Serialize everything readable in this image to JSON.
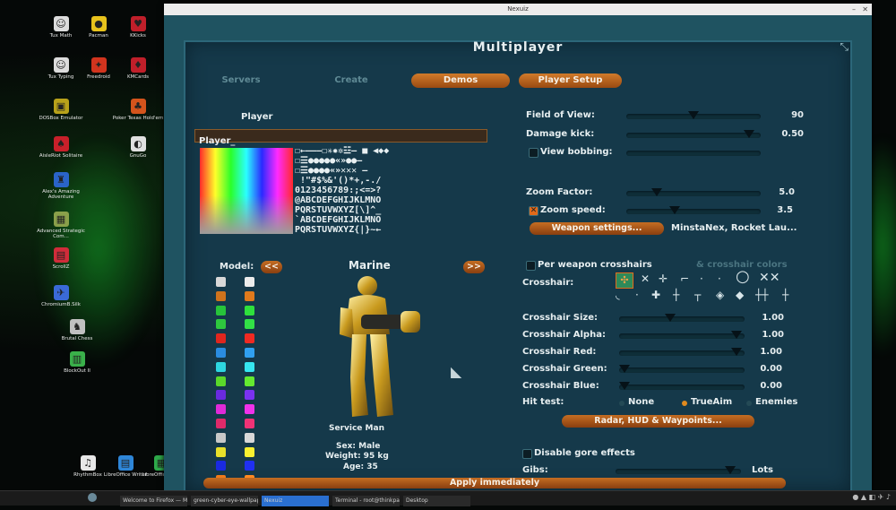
{
  "window": {
    "title": "Nexuiz"
  },
  "desktop_icons": [
    {
      "label": "Tux Math",
      "color": "#dcdcdc",
      "glyph": "☺"
    },
    {
      "label": "Pacman",
      "color": "#e8c21c",
      "glyph": "●"
    },
    {
      "label": "KKicks",
      "color": "#c01f2a",
      "glyph": "♥"
    },
    {
      "label": "Tux Typing",
      "color": "#dcdcdc",
      "glyph": "☺"
    },
    {
      "label": "Freedroid",
      "color": "#d2341e",
      "glyph": "✦"
    },
    {
      "label": "KMCards",
      "color": "#c01f2a",
      "glyph": "♦"
    },
    {
      "label": "DOSBox Emulator",
      "color": "#b8a21a",
      "glyph": "▣"
    },
    {
      "label": "Poker Texas Hold'em",
      "color": "#d4541c",
      "glyph": "♣"
    },
    {
      "label": "AisleRiot Solitaire",
      "color": "#c8202a",
      "glyph": "♠"
    },
    {
      "label": "GnuGo",
      "color": "#e0e0e0",
      "glyph": "◐"
    },
    {
      "label": "Alex's Amazing Adventure",
      "color": "#2a64c8",
      "glyph": "♜"
    },
    {
      "label": "Advanced Strategic Com...",
      "color": "#8aa04a",
      "glyph": "▦"
    },
    {
      "label": "ScrollZ",
      "color": "#d02c3a",
      "glyph": "▤"
    },
    {
      "label": "ChromiumB.Silk",
      "color": "#3a6ad8",
      "glyph": "✈"
    },
    {
      "label": "Brutal Chess",
      "color": "#c0c0c0",
      "glyph": "♞"
    },
    {
      "label": "BlockOut II",
      "color": "#3ab04a",
      "glyph": "▥"
    },
    {
      "label": "RhythmBox",
      "color": "#e8e8e8",
      "glyph": "♫"
    },
    {
      "label": "LibreOffice Writer",
      "color": "#2e86d8",
      "glyph": "▤"
    },
    {
      "label": "LibreOffice Calc",
      "color": "#2eaa4a",
      "glyph": "▦"
    }
  ],
  "tabs": {
    "servers": "Servers",
    "create": "Create",
    "demos": "Demos",
    "player_setup": "Player Setup"
  },
  "header": {
    "title": "Multiplayer"
  },
  "player": {
    "section_label": "Player",
    "name": "Player_",
    "charmap_rows": [
      "☐←———☐✳✹✲☳— ■ ◀◆◆",
      "☐☰●●●●●«»●●—",
      "☐☰●●●●«»✕✕✕ —",
      " !\"#$%&'()*+,-./",
      "0123456789:;<=>?",
      "@ABCDEFGHIJKLMNO",
      "PQRSTUVWXYZ[\\]^_",
      "`ABCDEFGHIJKLMNO",
      "PQRSTUVWXYZ{|}~←"
    ]
  },
  "model": {
    "label": "Model:",
    "prev": "<<",
    "next": ">>",
    "name": "Marine",
    "caption": "Service Man",
    "sex": "Sex: Male",
    "weight": "Weight: 95 kg",
    "age": "Age: 35",
    "colors_left": [
      "#d8d8d8",
      "#d0731c",
      "#27c43a",
      "#2ec83e",
      "#e0261e",
      "#2a8ce0",
      "#2ed6e0",
      "#5ad82a",
      "#6a2ae0",
      "#e02ad8",
      "#e02a6a",
      "#c8c8c8",
      "#e8e02a",
      "#1a2ae0",
      "#f07a1a"
    ],
    "colors_right": [
      "#ececec",
      "#e07a1c",
      "#2ee03c",
      "#32e046",
      "#f02a22",
      "#30a0f0",
      "#36e6f0",
      "#64ea30",
      "#7a32f0",
      "#f032ea",
      "#f03276",
      "#d8d8d8",
      "#f8f030",
      "#2030f0",
      "#ff8a22"
    ]
  },
  "settings": {
    "field_of_view": {
      "label": "Field of View:",
      "value": "90",
      "level": 0.5
    },
    "damage_kick": {
      "label": "Damage kick:",
      "value": "0.50",
      "level": 0.95
    },
    "view_bobbing": {
      "label": "View bobbing:",
      "checked": false
    },
    "zoom_factor": {
      "label": "Zoom Factor:",
      "value": "5.0",
      "level": 0.2
    },
    "zoom_speed": {
      "label": "Zoom speed:",
      "value": "3.5",
      "level": 0.35,
      "checked": true
    },
    "weapon_settings": {
      "button": "Weapon settings...",
      "value": "MinstaNex, Rocket Lau..."
    },
    "per_weapon_crosshairs": {
      "label": "Per weapon crosshairs",
      "checked": false
    },
    "crosshair_colors": {
      "label": "& crosshair colors"
    },
    "crosshair_label": "Crosshair:",
    "crosshair_size": {
      "label": "Crosshair Size:",
      "value": "1.00",
      "level": 0.4
    },
    "crosshair_alpha": {
      "label": "Crosshair Alpha:",
      "value": "1.00",
      "level": 0.98
    },
    "crosshair_red": {
      "label": "Crosshair Red:",
      "value": "1.00",
      "level": 0.98
    },
    "crosshair_green": {
      "label": "Crosshair Green:",
      "value": "0.00",
      "level": 0.0
    },
    "crosshair_blue": {
      "label": "Crosshair Blue:",
      "value": "0.00",
      "level": 0.0
    },
    "hit_test": {
      "label": "Hit test:",
      "options": [
        "None",
        "TrueAim",
        "Enemies"
      ],
      "selected": "TrueAim"
    },
    "radar_button": "Radar, HUD & Waypoints...",
    "disable_gore": {
      "label": "Disable gore effects",
      "checked": false
    },
    "gibs": {
      "label": "Gibs:",
      "value": "Lots",
      "level": 0.95
    }
  },
  "apply_button": "Apply immediately",
  "taskbar": {
    "items": [
      "Welcome to Firefox — Mo...",
      "green-cyber-eye-wallpape...",
      "Nexuiz",
      "Terminal - root@thinkpad...",
      "Desktop"
    ]
  },
  "colors": {
    "accent": "#d0731c",
    "panel": "#15394a"
  }
}
